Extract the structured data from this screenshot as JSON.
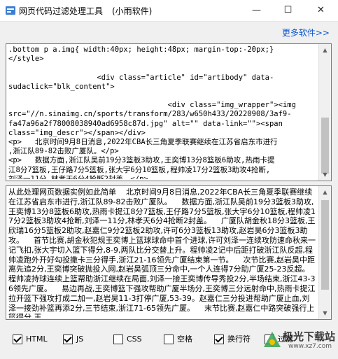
{
  "window": {
    "title": "网页代码过滤处理工具",
    "subtitle": "(小雨软件)",
    "controls": {
      "minimize": "—",
      "maximize": "☐",
      "close": "✕"
    }
  },
  "more_link": "更多软件>>",
  "source_pane": {
    "content": ".bottom p a.img{ width:40px; height:48px; margin-top:-20px;}\n</style>\n\n                    <div class=\"article\" id=\"artibody\" data-\nsudaclick=\"blk_content\">\n\n                                    <div class=\"img_wrapper\"><img\nsrc=\"//n.sinaimg.cn/sports/transform/283/w650h433/20220908/3af9-\nfa47a96a2f78008038940ad6958c87d.jpg\" alt=\"\" data-link=\"\"><span\nclass=\"img_descr\"></span></div>\n<p>   北京时间9月8日消息,2022年CBA长三角夏季联赛继续在江苏省启东市进行\n,浙江队89-82击败广厦队。</p>\n<p>   数据方面,浙江队吴前19分3篮板3助攻,王奕博13分8篮板6助攻,热雨卡提\n江8分7篮板,王仔路7分5篮板,张大宇6分10篮板,程帅凌17分2篮板3助攻4抢断,\n刘泽一11分,林孝天6分4抢断2封盖。</p>"
  },
  "result_pane": {
    "content": "从此处理网页数据实例如此简单    北京时间9月8日消息,2022年CBA长三角夏季联赛继续在江苏省启东市进行,浙江队89-82击败广厦队。    数据方面,浙江队吴前19分3篮板3助攻,王奕博13分8篮板6助攻,热雨卡提江8分7篮板,王仔路7分5篮板,张大宇6分10篮板,程帅凌17分2篮板3助攻4抢断,刘泽一11分,林孝天6分4抢断2封盖。    广厦队胡金秋18分3篮板,王欣瑞16分5篮板2助攻,赵嘉仁9分2篮板2助攻,许可6分3篮板13助攻,赵岩昊6分3篮板3助攻。    首节比赛,胡金秋犯规王奕博上篮球球命中首个进球,许可刘泽一连续攻防速命秋来一记飞扣,张大宇切入篮下得分,8-9,两队比分交替上升。程帅凌2记中后距打破浙江队反超,程帅凌跑外开好勾投撒卡三分得手,浙江21-16领先广厦结束第一节。    次节比赛,赵岩昊中距离先追2分,王奕博突破抛投入网,赵岩昊弧顶三分命中,一个人连得7分助广厦25-23反超。程帅凌持球连续上篮帮助浙江继续在局面,刘泽一接王奕博传导秀投2分,半场结束,浙江43-36领先广厦。    易边再战,王奕博篮下强攻帮助广厦半场分,王奕博三分远射命中,热雨卡提江拉开篮下强攻打成二加一,赵岩昊11-3打停广厦,53-39。赵嘉仁三分投进帮助广厦止血,刘泽一接劲补篮再添2分,三节结束,浙江71-65领先广厦。    末节比赛,赵嘉仁中路突破强行上篮得分,王"
  },
  "options": [
    {
      "label": "HTML",
      "checked": true
    },
    {
      "label": "JS",
      "checked": true
    },
    {
      "label": "CSS",
      "checked": false
    },
    {
      "label": "空格",
      "checked": false
    },
    {
      "label": "换行符",
      "checked": true
    },
    {
      "label": "过滤",
      "checked": false
    }
  ],
  "watermark": {
    "text": "极光下载站",
    "sub": "www.xz7.com"
  },
  "colors": {
    "link": "#0b57d0",
    "pane_border": "#7a7a7a",
    "background": "#f0f0f0"
  }
}
